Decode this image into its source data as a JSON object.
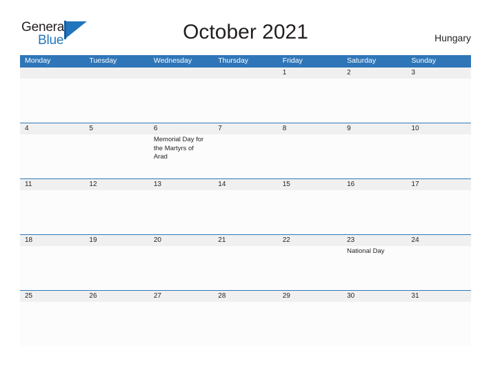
{
  "brand": {
    "name_part1": "General",
    "name_part2": "Blue",
    "logo_icon": "general-blue-triangle-logo"
  },
  "header": {
    "title": "October 2021",
    "country": "Hungary"
  },
  "calendar": {
    "weekday_headers": [
      "Monday",
      "Tuesday",
      "Wednesday",
      "Thursday",
      "Friday",
      "Saturday",
      "Sunday"
    ],
    "colors": {
      "header_blue": "#2f76b8",
      "date_band_gray": "#f0f0f0",
      "cell_background": "#fcfcfd",
      "text_dark": "#231f20",
      "logo_blue": "#2175bd"
    },
    "weeks": [
      {
        "days": [
          {
            "number": "",
            "event": ""
          },
          {
            "number": "",
            "event": ""
          },
          {
            "number": "",
            "event": ""
          },
          {
            "number": "",
            "event": ""
          },
          {
            "number": "1",
            "event": ""
          },
          {
            "number": "2",
            "event": ""
          },
          {
            "number": "3",
            "event": ""
          }
        ]
      },
      {
        "days": [
          {
            "number": "4",
            "event": ""
          },
          {
            "number": "5",
            "event": ""
          },
          {
            "number": "6",
            "event": "Memorial Day for the Martyrs of Arad"
          },
          {
            "number": "7",
            "event": ""
          },
          {
            "number": "8",
            "event": ""
          },
          {
            "number": "9",
            "event": ""
          },
          {
            "number": "10",
            "event": ""
          }
        ]
      },
      {
        "days": [
          {
            "number": "11",
            "event": ""
          },
          {
            "number": "12",
            "event": ""
          },
          {
            "number": "13",
            "event": ""
          },
          {
            "number": "14",
            "event": ""
          },
          {
            "number": "15",
            "event": ""
          },
          {
            "number": "16",
            "event": ""
          },
          {
            "number": "17",
            "event": ""
          }
        ]
      },
      {
        "days": [
          {
            "number": "18",
            "event": ""
          },
          {
            "number": "19",
            "event": ""
          },
          {
            "number": "20",
            "event": ""
          },
          {
            "number": "21",
            "event": ""
          },
          {
            "number": "22",
            "event": ""
          },
          {
            "number": "23",
            "event": "National Day"
          },
          {
            "number": "24",
            "event": ""
          }
        ]
      },
      {
        "days": [
          {
            "number": "25",
            "event": ""
          },
          {
            "number": "26",
            "event": ""
          },
          {
            "number": "27",
            "event": ""
          },
          {
            "number": "28",
            "event": ""
          },
          {
            "number": "29",
            "event": ""
          },
          {
            "number": "30",
            "event": ""
          },
          {
            "number": "31",
            "event": ""
          }
        ]
      }
    ]
  }
}
